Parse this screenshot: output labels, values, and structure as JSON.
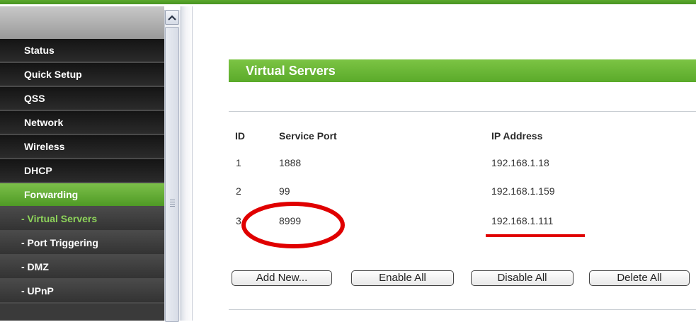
{
  "sidebar": {
    "items": [
      {
        "label": "Status",
        "kind": "top"
      },
      {
        "label": "Quick Setup",
        "kind": "top"
      },
      {
        "label": "QSS",
        "kind": "top"
      },
      {
        "label": "Network",
        "kind": "top"
      },
      {
        "label": "Wireless",
        "kind": "top"
      },
      {
        "label": "DHCP",
        "kind": "top"
      },
      {
        "label": "Forwarding",
        "kind": "active"
      },
      {
        "label": "- Virtual Servers",
        "kind": "current"
      },
      {
        "label": "- Port Triggering",
        "kind": "sub"
      },
      {
        "label": "- DMZ",
        "kind": "sub"
      },
      {
        "label": "- UPnP",
        "kind": "sub"
      }
    ],
    "scroll_up_icon": "chevron-up-icon"
  },
  "main": {
    "title": "Virtual Servers",
    "table": {
      "headers": {
        "id": "ID",
        "service_port": "Service Port",
        "ip_address": "IP Address"
      },
      "rows": [
        {
          "id": "1",
          "service_port": "1888",
          "ip_address": "192.168.1.18"
        },
        {
          "id": "2",
          "service_port": "99",
          "ip_address": "192.168.1.159"
        },
        {
          "id": "3",
          "service_port": "8999",
          "ip_address": "192.168.1.111"
        }
      ]
    },
    "buttons": {
      "add_new": "Add New...",
      "enable_all": "Enable All",
      "disable_all": "Disable All",
      "delete_all": "Delete All"
    }
  },
  "colors": {
    "accent_green": "#5aaa2a",
    "annotation_red": "#e00000"
  }
}
